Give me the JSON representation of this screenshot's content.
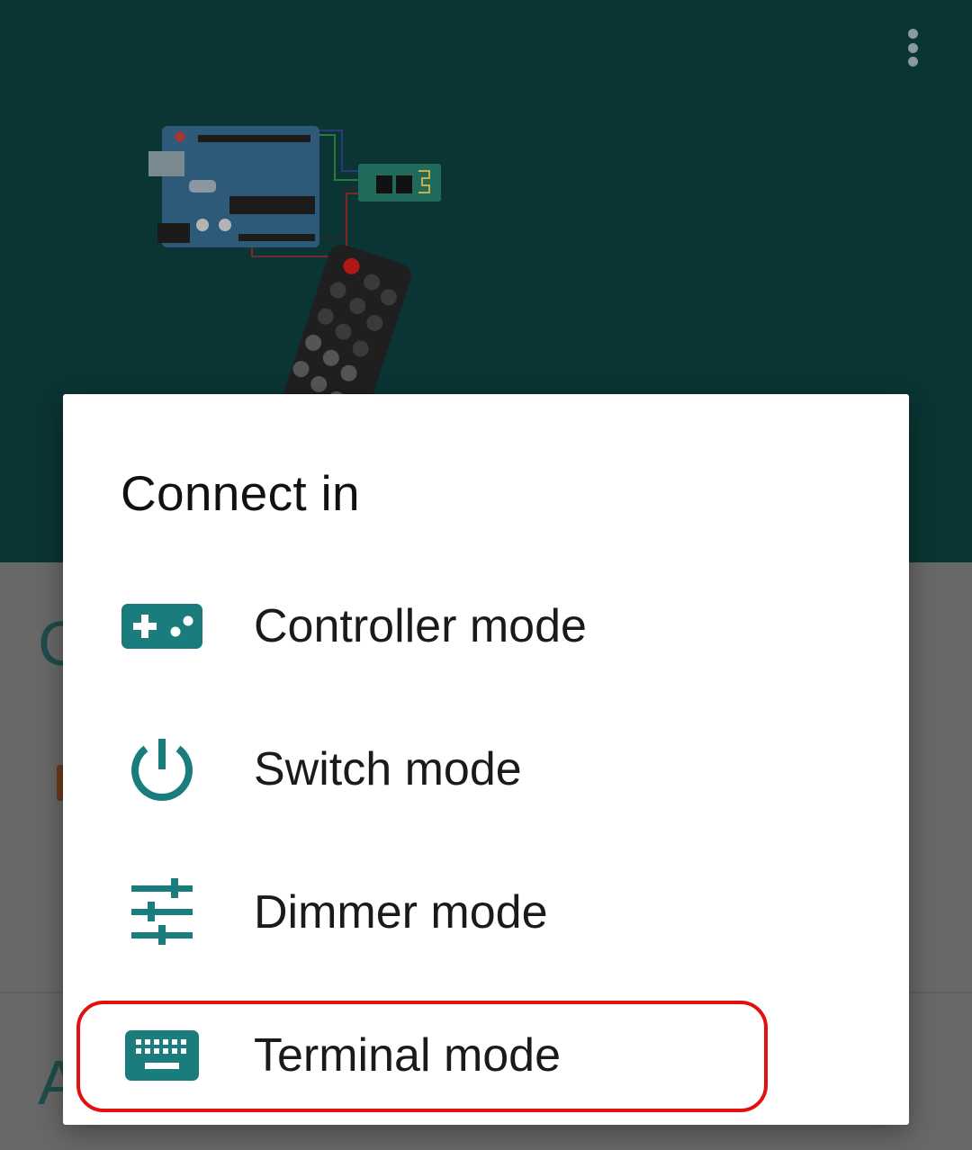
{
  "colors": {
    "header_bg": "#0b3434",
    "accent_teal": "#1a7c7c",
    "highlight_red": "#e41010",
    "dialog_bg": "#ffffff"
  },
  "header": {
    "menu_icon": "more-vert-icon",
    "illustration": "arduino-bluetooth-remote-illustration"
  },
  "dialog": {
    "title": "Connect in",
    "items": [
      {
        "label": "Controller mode",
        "icon": "gamepad-icon"
      },
      {
        "label": "Switch mode",
        "icon": "power-icon"
      },
      {
        "label": "Dimmer mode",
        "icon": "tune-sliders-icon"
      },
      {
        "label": "Terminal mode",
        "icon": "keyboard-icon"
      }
    ]
  }
}
